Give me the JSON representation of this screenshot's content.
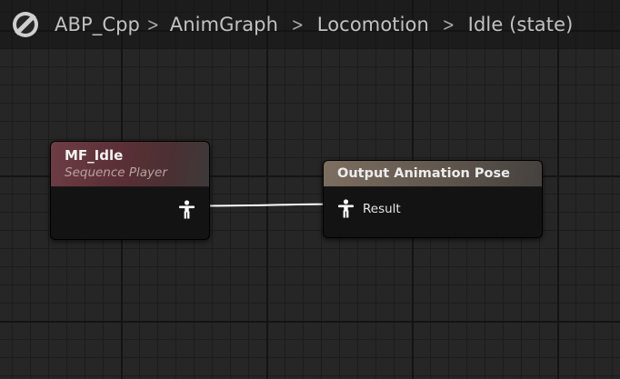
{
  "breadcrumb": {
    "icon": "blueprint-icon",
    "items": [
      "ABP_Cpp",
      "AnimGraph",
      "Locomotion",
      "Idle (state)"
    ]
  },
  "nodes": {
    "sequence_player": {
      "title": "MF_Idle",
      "subtitle": "Sequence Player",
      "header_color": "#6e3c44",
      "output_pin_icon": "pose-icon"
    },
    "output_pose": {
      "title": "Output Animation Pose",
      "header_color": "#7d6e60",
      "input_pin_label": "Result",
      "input_pin_icon": "pose-icon"
    }
  },
  "colors": {
    "graph_background": "#262626",
    "wire": "#ffffff"
  }
}
